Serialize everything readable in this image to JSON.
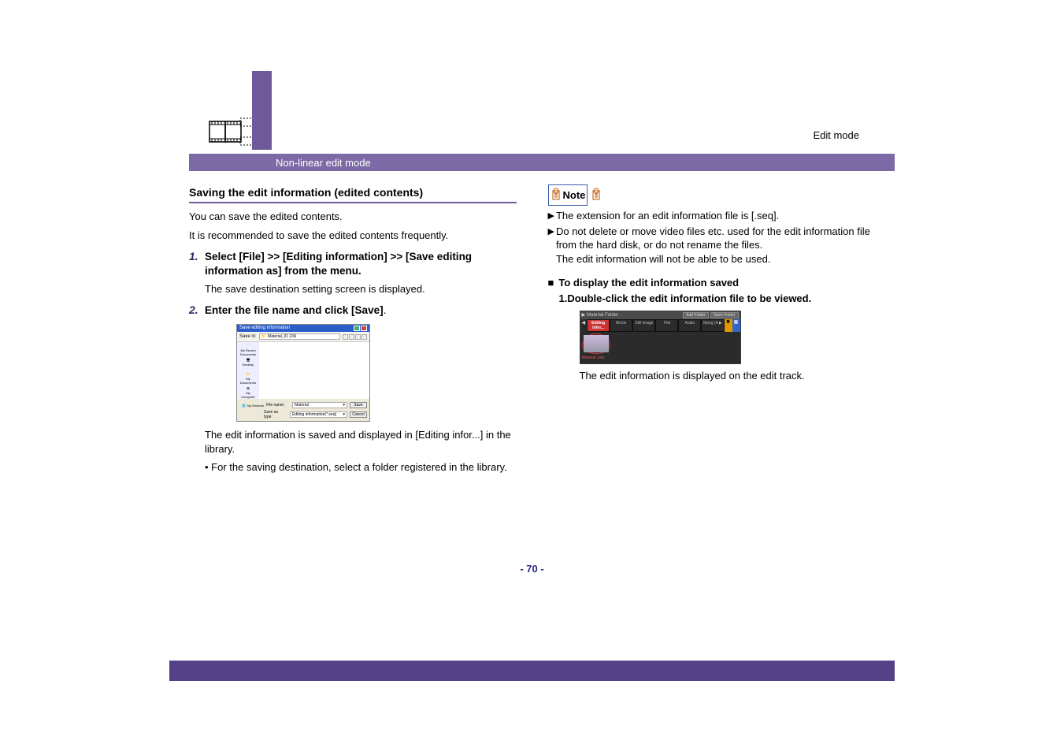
{
  "header": {
    "edit_mode": "Edit mode",
    "purple_bar": "Non-linear edit mode"
  },
  "left": {
    "title": "Saving the edit information (edited contents)",
    "p1": "You can save the edited contents.",
    "p2": "It is recommended to save the edited contents frequently.",
    "step1_num": "1.",
    "step1": "Select [File] >> [Editing information] >> [Save editing information as] from the menu.",
    "step1_body": "The save destination setting screen is displayed.",
    "step2_num": "2.",
    "step2_a": "Enter the file name and click [Save]",
    "step2_b": ".",
    "result1": "The edit information is saved and displayed in [Editing infor...] in the library.",
    "bullet1": "• For the saving destination, select a folder registered in the library.",
    "dialog": {
      "title": "Save editing information",
      "savein_label": "Save in:",
      "savein_value": "Material_01 (24)",
      "left_items": [
        "My Recent Documents",
        "Desktop",
        "My Documents",
        "My Computer",
        "My Network"
      ],
      "file_label": "File name:",
      "file_value": "Material",
      "type_label": "Save as type:",
      "type_value": "Editing information(*.seq)",
      "save_btn": "Save",
      "cancel_btn": "Cancel"
    }
  },
  "right": {
    "note_label": "Note",
    "note1": "The extension for an edit information file is [.seq].",
    "note2": "Do not delete or move video files etc. used for the edit information file from the hard disk, or do not rename the files.",
    "note2b": "The edit information will not be able to be used.",
    "sub_heading": "To display the edit information saved",
    "sub_step1": "1.Double-click the edit information file to be viewed.",
    "result": "The edit information is displayed on the edit track.",
    "library": {
      "top_title": "Material Folder",
      "add_folder": "Add Folder",
      "open_folder": "Open Folder",
      "tabs": [
        "Editing infor...",
        "Movie",
        "Still image",
        "Title",
        "Audio",
        "Mpeg (A ▶"
      ],
      "thumb_label": "Material .seq"
    }
  },
  "page_number": "- 70 -"
}
